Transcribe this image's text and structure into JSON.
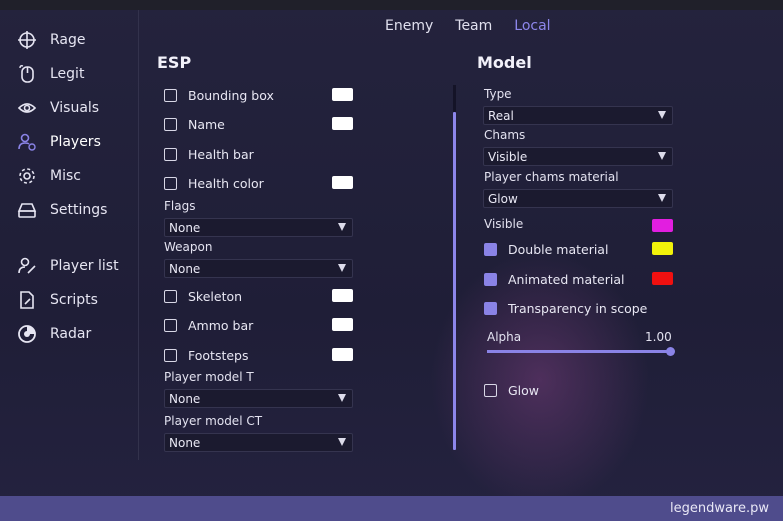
{
  "sidebar": {
    "items": [
      {
        "label": "Rage",
        "icon": "crosshair-icon"
      },
      {
        "label": "Legit",
        "icon": "mouse-icon"
      },
      {
        "label": "Visuals",
        "icon": "eye-icon"
      },
      {
        "label": "Players",
        "icon": "users-icon",
        "active": true
      },
      {
        "label": "Misc",
        "icon": "gear-icon"
      },
      {
        "label": "Settings",
        "icon": "hard-drive-icon"
      },
      {
        "label": "Player list",
        "icon": "user-edit-icon"
      },
      {
        "label": "Scripts",
        "icon": "file-edit-icon"
      },
      {
        "label": "Radar",
        "icon": "radar-icon"
      }
    ]
  },
  "tabs": {
    "items": [
      "Enemy",
      "Team",
      "Local"
    ],
    "active": "Local"
  },
  "esp": {
    "title": "ESP",
    "bounding_box": "Bounding box",
    "name": "Name",
    "health_bar": "Health bar",
    "health_color": "Health color",
    "flags_label": "Flags",
    "flags_value": "None",
    "weapon_label": "Weapon",
    "weapon_value": "None",
    "skeleton": "Skeleton",
    "ammo_bar": "Ammo bar",
    "footsteps": "Footsteps",
    "player_model_t_label": "Player model T",
    "player_model_t_value": "None",
    "player_model_ct_label": "Player model CT",
    "player_model_ct_value": "None"
  },
  "model": {
    "title": "Model",
    "type_label": "Type",
    "type_value": "Real",
    "chams_label": "Chams",
    "chams_value": "Visible",
    "material_label": "Player chams material",
    "material_value": "Glow",
    "visible_label": "Visible",
    "double_material": "Double material",
    "animated_material": "Animated material",
    "transparency": "Transparency in scope",
    "alpha_label": "Alpha",
    "alpha_value": "1.00",
    "glow": "Glow"
  },
  "colors": {
    "accent": "#8a83e6",
    "visible_swatch": "#e21ee0",
    "double_swatch": "#f2f20a",
    "animated_swatch": "#f01010",
    "white_swatch": "#ffffff"
  },
  "footer": {
    "brand": "legendware.pw"
  }
}
